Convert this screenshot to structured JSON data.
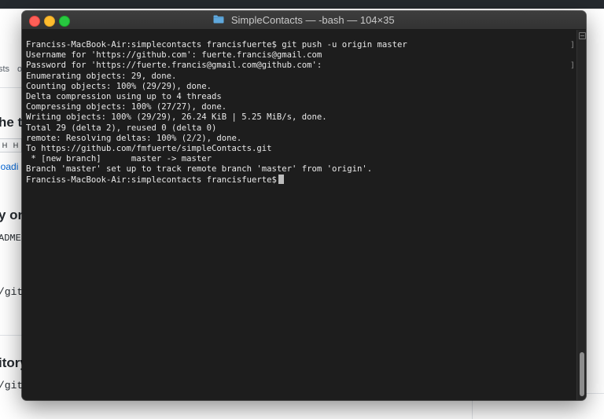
{
  "background": {
    "fragments": {
      "f1": "sts",
      "f2": "o",
      "f3": "he th",
      "f4": "H",
      "f5": "H",
      "f6": "loadi",
      "f7": "y on",
      "f8": "ADME",
      "f9": "/git",
      "f10": "itory",
      "f11": "/git"
    }
  },
  "window": {
    "title": "SimpleContacts — -bash — 104×35"
  },
  "terminal": {
    "lines": [
      "Franciss-MacBook-Air:simplecontacts francisfuerte$ git push -u origin master",
      "Username for 'https://github.com': fuerte.francis@gmail.com",
      "Password for 'https://fuerte.francis@gmail.com@github.com':",
      "Enumerating objects: 29, done.",
      "Counting objects: 100% (29/29), done.",
      "Delta compression using up to 4 threads",
      "Compressing objects: 100% (27/27), done.",
      "Writing objects: 100% (29/29), 26.24 KiB | 5.25 MiB/s, done.",
      "Total 29 (delta 2), reused 0 (delta 0)",
      "remote: Resolving deltas: 100% (2/2), done.",
      "To https://github.com/fmfuerte/simpleContacts.git",
      " * [new branch]      master -> master",
      "Branch 'master' set up to track remote branch 'master' from 'origin'."
    ],
    "prompt": "Franciss-MacBook-Air:simplecontacts francisfuerte$ ",
    "bracket_mark": "]"
  },
  "colors": {
    "terminal_bg": "#1d1d1d",
    "terminal_text": "#e8e8e8",
    "close": "#fe5f57",
    "minimize": "#febc2e",
    "maximize": "#28c840",
    "folder": "#5fa8dc"
  },
  "icons": {
    "title": "folder-icon",
    "scroll": "scroll-top-icon"
  }
}
